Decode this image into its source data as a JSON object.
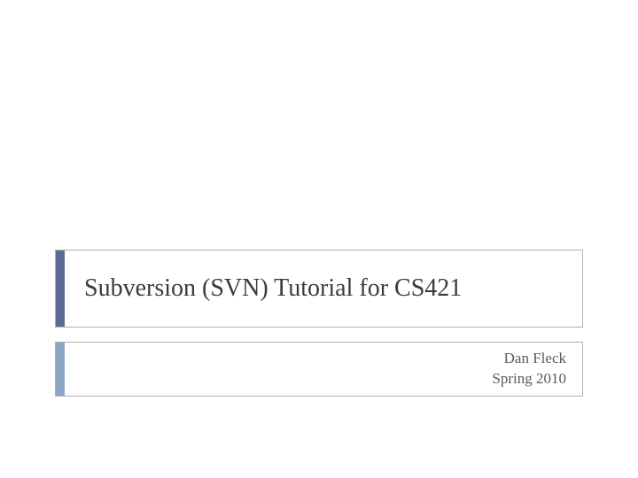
{
  "slide": {
    "title": "Subversion (SVN) Tutorial for CS421",
    "author": "Dan Fleck",
    "term": "Spring 2010"
  }
}
